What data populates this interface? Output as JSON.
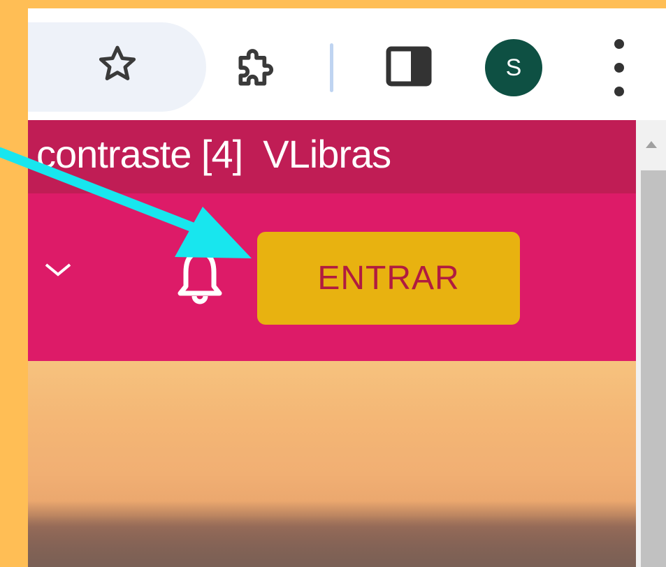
{
  "toolbar": {
    "bookmark_icon": "star-icon",
    "extensions_icon": "puzzle-icon",
    "side_panel_icon": "side-panel-icon",
    "profile_initial": "S",
    "profile_color": "#0E5043",
    "menu_icon": "kebab-menu-icon"
  },
  "accessibility_bar": {
    "text": "contraste [4]  VLibras",
    "background": "#C01D55"
  },
  "header": {
    "background": "#DD1B68",
    "dropdown_icon": "chevron-down-icon",
    "notifications_icon": "bell-icon",
    "login_label": "ENTRAR",
    "login_bg": "#E8B210",
    "login_text_color": "#B01B40"
  },
  "annotation": {
    "arrow_color": "#18E6EE",
    "frame_color": "#FFBE55"
  }
}
